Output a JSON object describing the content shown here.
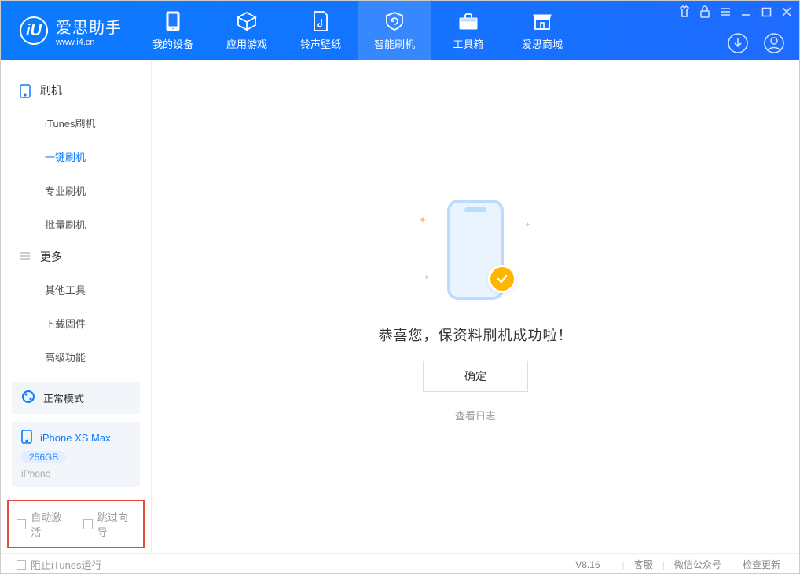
{
  "app": {
    "name": "爱思助手",
    "url": "www.i4.cn"
  },
  "tabs": [
    {
      "id": "device",
      "label": "我的设备"
    },
    {
      "id": "apps",
      "label": "应用游戏"
    },
    {
      "id": "ringt",
      "label": "铃声壁纸"
    },
    {
      "id": "flash",
      "label": "智能刷机",
      "active": true
    },
    {
      "id": "tools",
      "label": "工具箱"
    },
    {
      "id": "store",
      "label": "爱思商城"
    }
  ],
  "sidebar": {
    "group1_label": "刷机",
    "items1": [
      {
        "label": "iTunes刷机"
      },
      {
        "label": "一键刷机",
        "active": true
      },
      {
        "label": "专业刷机"
      },
      {
        "label": "批量刷机"
      }
    ],
    "group2_label": "更多",
    "items2": [
      {
        "label": "其他工具"
      },
      {
        "label": "下载固件"
      },
      {
        "label": "高级功能"
      }
    ],
    "mode_label": "正常模式",
    "device": {
      "name": "iPhone XS Max",
      "capacity": "256GB",
      "type": "iPhone"
    },
    "opt_auto_activate": "自动激活",
    "opt_skip_guide": "跳过向导"
  },
  "main": {
    "success_msg": "恭喜您，保资料刷机成功啦！",
    "ok_label": "确定",
    "log_label": "查看日志"
  },
  "footer": {
    "block_itunes": "阻止iTunes运行",
    "version": "V8.16",
    "svc": "客服",
    "wechat": "微信公众号",
    "update": "检查更新"
  }
}
